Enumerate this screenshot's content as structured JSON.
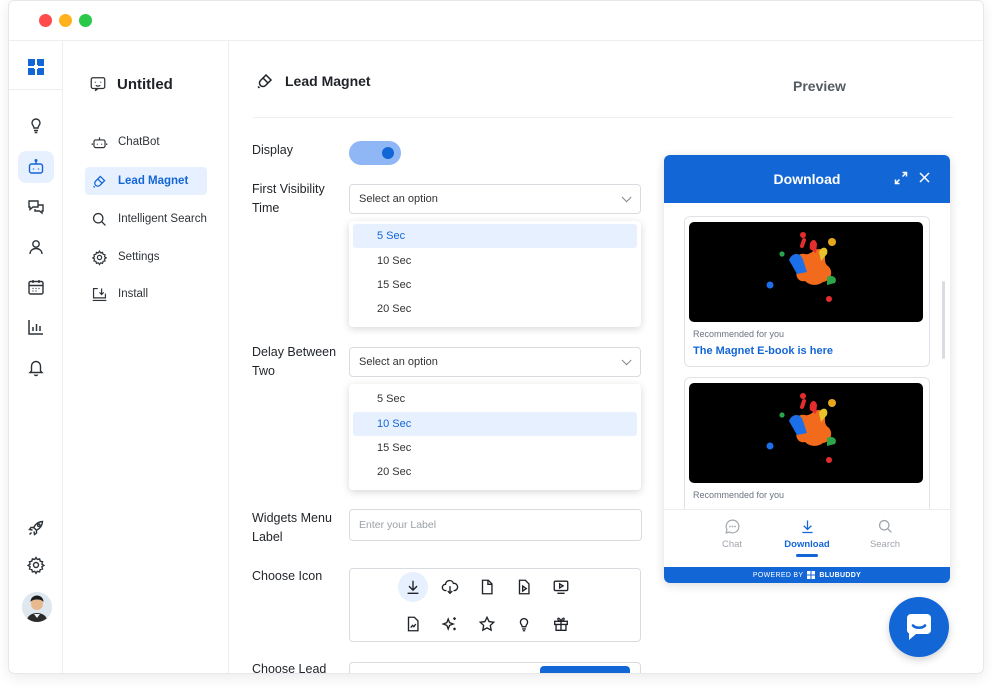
{
  "window": {
    "controls": [
      "close",
      "minimize",
      "maximize"
    ]
  },
  "rail": {
    "items": [
      {
        "name": "grid-logo-icon"
      },
      {
        "name": "lightbulb-icon"
      },
      {
        "name": "bot-icon",
        "active": true
      },
      {
        "name": "chat-icon"
      },
      {
        "name": "user-icon"
      },
      {
        "name": "calendar-icon"
      },
      {
        "name": "bar-chart-icon"
      },
      {
        "name": "bell-icon"
      },
      {
        "name": "rocket-icon"
      },
      {
        "name": "gear-icon"
      }
    ],
    "avatar": "avatar"
  },
  "subnav": {
    "title": "Untitled",
    "items": [
      {
        "label": "ChatBot",
        "icon": "bot-icon"
      },
      {
        "label": "Lead Magnet",
        "icon": "magnet-icon",
        "active": true
      },
      {
        "label": "Intelligent Search",
        "icon": "search-icon"
      },
      {
        "label": "Settings",
        "icon": "gear-icon"
      },
      {
        "label": "Install",
        "icon": "install-icon"
      }
    ]
  },
  "main": {
    "title": "Lead Magnet",
    "preview_label": "Preview",
    "display_label": "Display",
    "display_on": true,
    "first_visibility": {
      "label": "First Visibility Time",
      "placeholder": "Select an option",
      "options": [
        "5 Sec",
        "10 Sec",
        "15 Sec",
        "20 Sec"
      ],
      "selected": "5 Sec"
    },
    "delay_between": {
      "label": "Delay Between Two",
      "placeholder": "Select an option",
      "options": [
        "5 Sec",
        "10 Sec",
        "15 Sec",
        "20 Sec"
      ],
      "selected": "10 Sec"
    },
    "widgets_menu": {
      "label": "Widgets Menu Label",
      "placeholder": "Enter your Label"
    },
    "choose_icon": {
      "label": "Choose Icon",
      "icons": [
        "download-icon",
        "cloud-download-icon",
        "file-icon",
        "file-play-icon",
        "video-icon",
        "file-chart-icon",
        "sparkle-icon",
        "star-icon",
        "lightbulb-icon",
        "gift-icon"
      ],
      "selected": "download-icon"
    },
    "choose_lead_label": "Choose Lead"
  },
  "widget": {
    "title": "Download",
    "cards": [
      {
        "recommended": "Recommended for you",
        "title": "The Magnet E-book is here"
      },
      {
        "recommended": "Recommended for you"
      }
    ],
    "tabs": [
      {
        "label": "Chat",
        "icon": "chat-icon"
      },
      {
        "label": "Download",
        "icon": "download-icon",
        "active": true
      },
      {
        "label": "Search",
        "icon": "search-icon"
      }
    ],
    "powered_by": "POWERED BY",
    "brand": "BLUBUDDY",
    "colors": {
      "primary": "#1366d6",
      "selected_bg": "#e7f0ff",
      "toggle_track": "#8fb7f6"
    }
  }
}
